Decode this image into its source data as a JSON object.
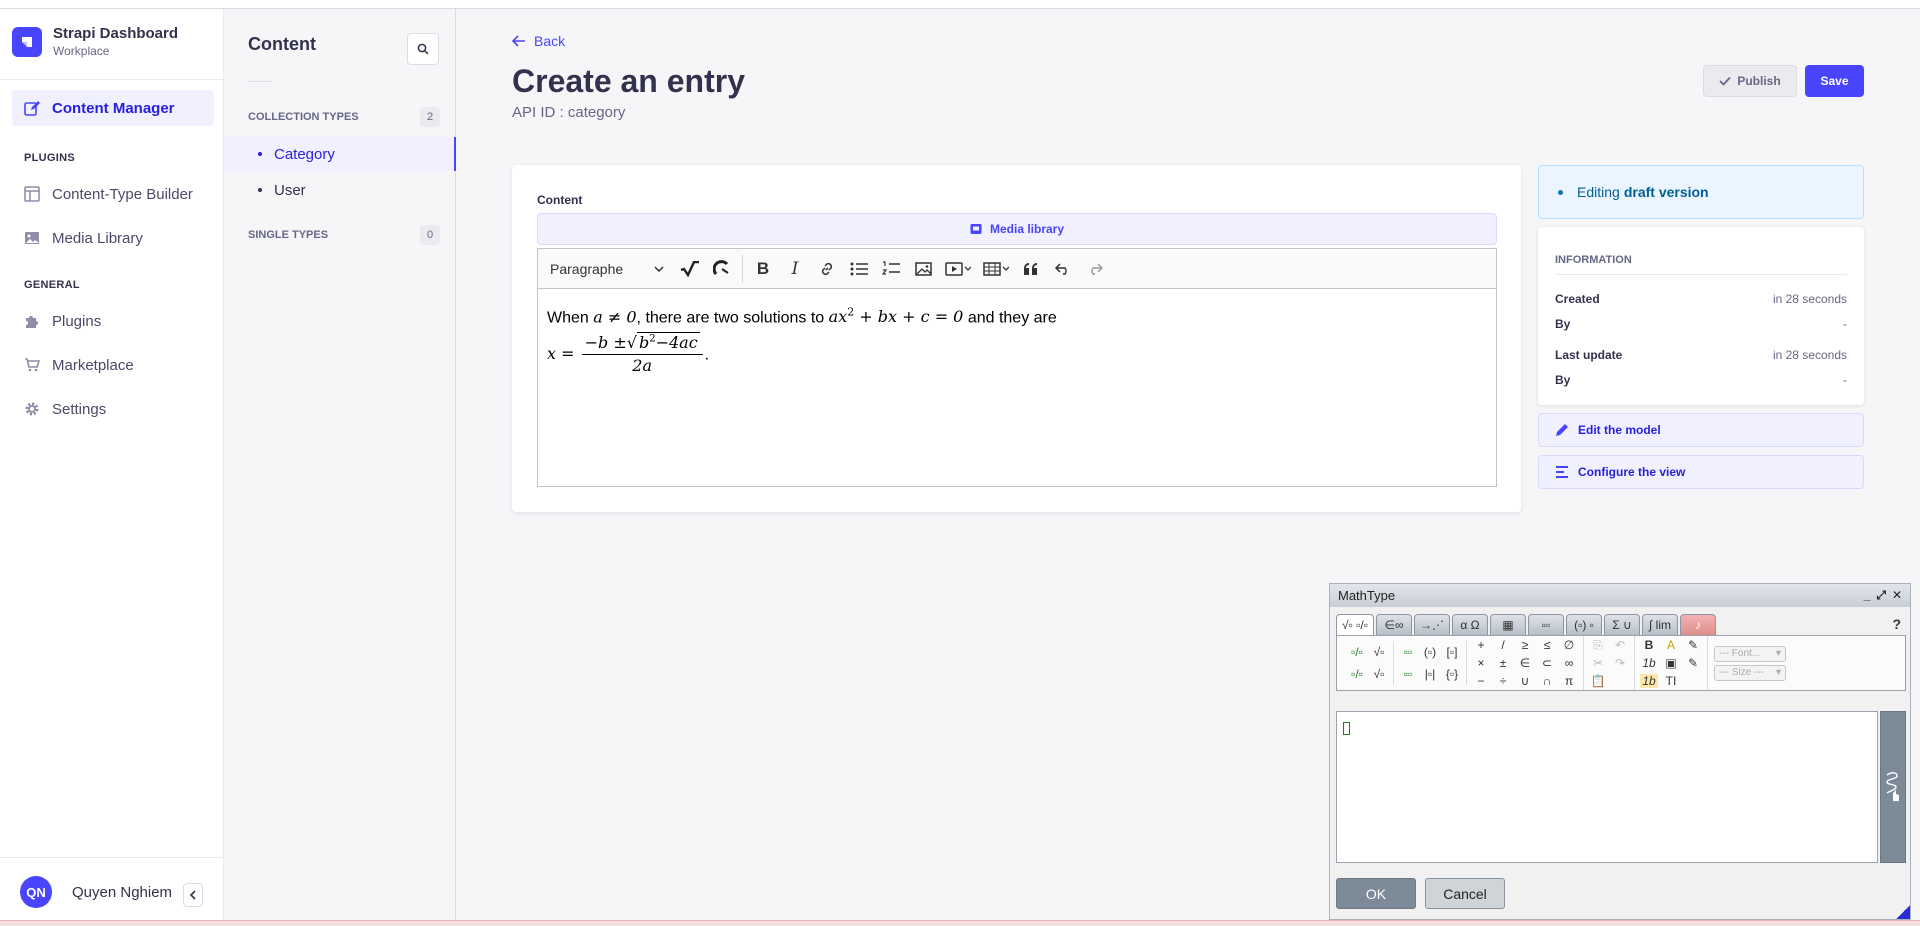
{
  "brand": {
    "title": "Strapi Dashboard",
    "subtitle": "Workplace"
  },
  "mainnav": {
    "content_manager": "Content Manager",
    "plugins_section": "PLUGINS",
    "content_type_builder": "Content-Type Builder",
    "media_library": "Media Library",
    "general_section": "GENERAL",
    "plugins": "Plugins",
    "marketplace": "Marketplace",
    "settings": "Settings"
  },
  "user": {
    "initials": "QN",
    "name": "Quyen Nghiem"
  },
  "subnav": {
    "title": "Content",
    "collection_types": "COLLECTION TYPES",
    "collection_count": "2",
    "items": [
      "Category",
      "User"
    ],
    "single_types": "SINGLE TYPES",
    "single_count": "0"
  },
  "header": {
    "back": "Back",
    "title": "Create an entry",
    "api_id": "API ID : category",
    "publish": "Publish",
    "save": "Save"
  },
  "editor": {
    "field_label": "Content",
    "media_library": "Media library",
    "format": "Paragraphe",
    "text_before": "When",
    "math_cond": "a ≠ 0",
    "text_mid": ", there are two solutions to",
    "math_eq_a": "ax",
    "math_exp": "2",
    "math_eq_b": " + bx + c = 0",
    "text_after": "and they are",
    "x_eq": "x =",
    "num_pre": "−b ±",
    "radicand_a": "b",
    "radicand_exp": "2",
    "radicand_b": "−4ac",
    "den": "2a",
    "period": "."
  },
  "sidebar": {
    "editing": "Editing",
    "draft": "draft version",
    "information": "INFORMATION",
    "created_label": "Created",
    "created_value": "in 28 seconds",
    "by_label": "By",
    "by_value": "-",
    "last_update_label": "Last update",
    "last_update_value": "in 28 seconds",
    "by2_label": "By",
    "by2_value": "-",
    "edit_model": "Edit the model",
    "configure_view": "Configure the view"
  },
  "mathtype": {
    "title": "MathType",
    "tabs": [
      "√▫ ▫/▫",
      "∈∞",
      "→⋰",
      "α Ω",
      "▦",
      "▫▫",
      "(▫) ▫",
      "Σ ∪",
      "∫ lim",
      "♪"
    ],
    "palette": {
      "g1": [
        "▫/▫",
        "▫/▫"
      ],
      "g2": [
        "√▫",
        "√▫"
      ],
      "g3": [
        "▫▫",
        "▫▫"
      ],
      "g4": [
        "(▫)",
        "|▫|"
      ],
      "g5": [
        "[▫]",
        "{▫}"
      ],
      "ops1": [
        "+",
        "×",
        "−"
      ],
      "ops2": [
        "/",
        "±",
        "÷"
      ],
      "ops3": [
        "≥",
        "∈",
        "∪"
      ],
      "ops4": [
        "≤",
        "⊂",
        "∩"
      ],
      "ops5": [
        "∅",
        "∞",
        "π"
      ],
      "edit1": [
        "⎘",
        "✂",
        "📋"
      ],
      "edit2": [
        "↶",
        "↷",
        ""
      ],
      "style1": [
        "B",
        "1b",
        "1b"
      ],
      "style2": [
        "A",
        "▣",
        "TI"
      ],
      "style3": [
        "✎",
        "✎",
        ""
      ]
    },
    "font": "--- Font...",
    "size": "--- Size ---",
    "help": "?",
    "ok": "OK",
    "cancel": "Cancel"
  },
  "colors": {
    "primary": "#4945ff",
    "primary_dark": "#271fe0",
    "draft_bg": "#eaf5ff"
  }
}
